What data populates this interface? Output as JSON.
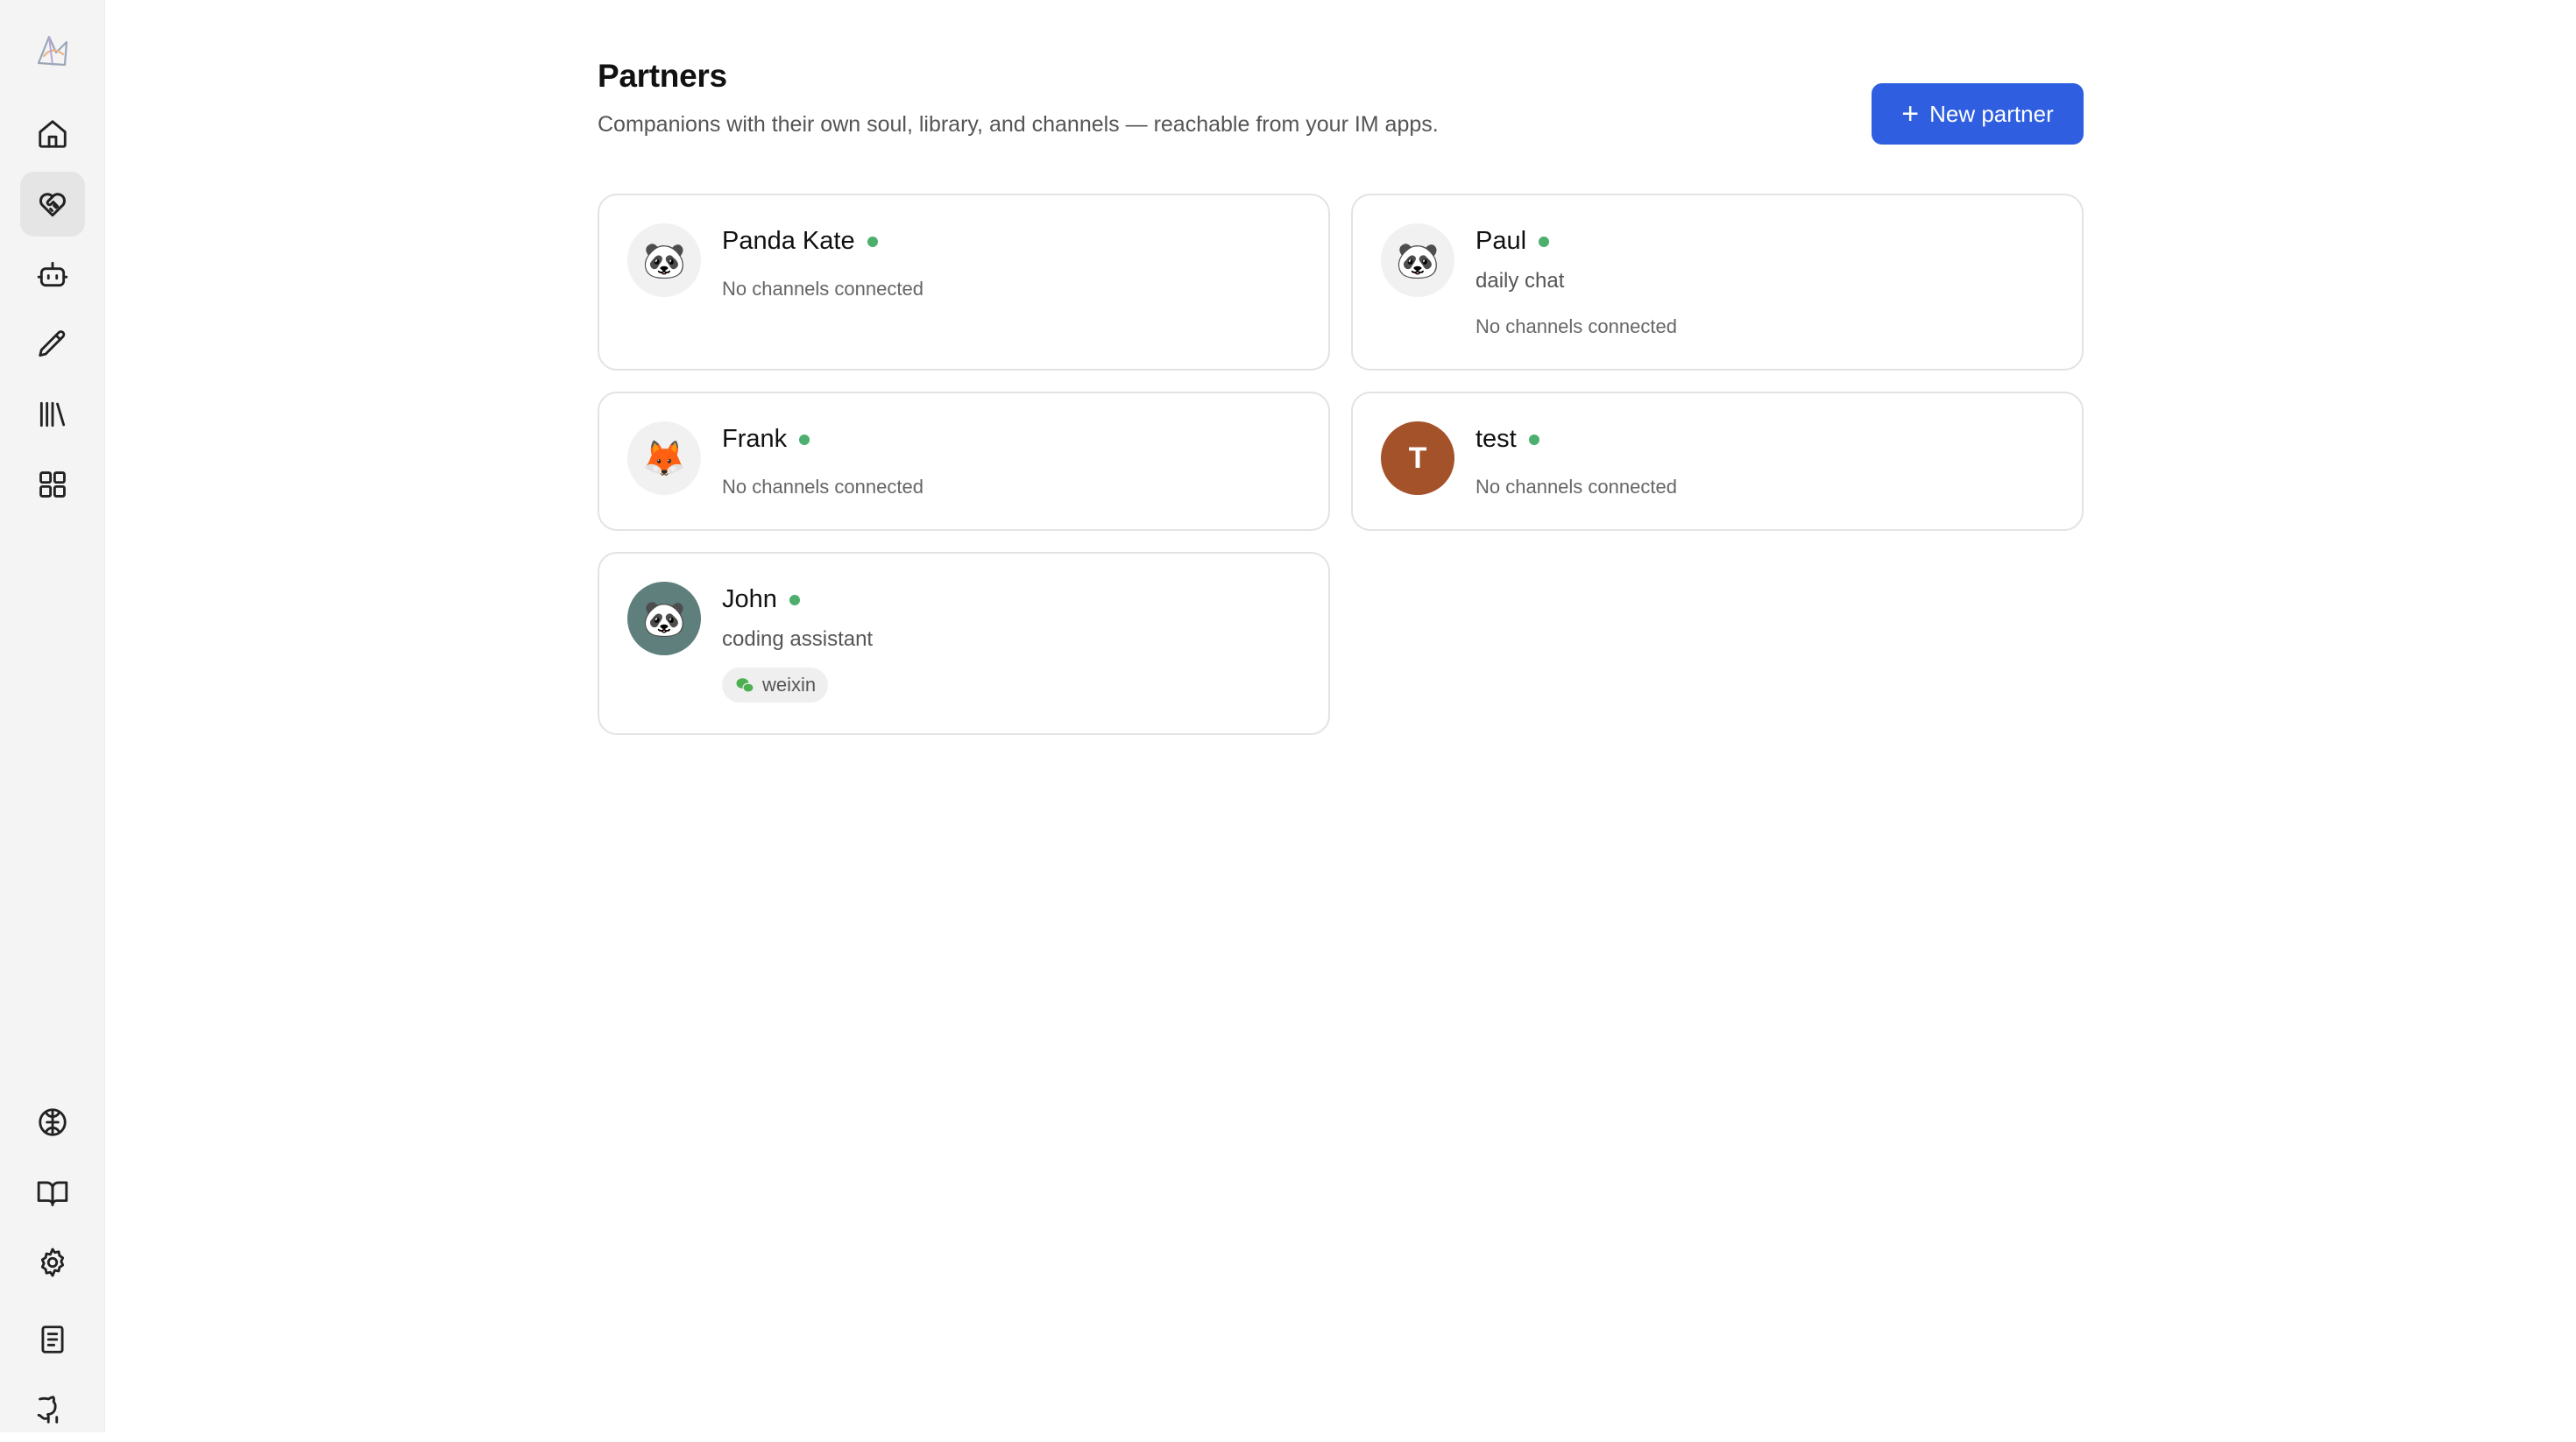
{
  "sidebar": {
    "logo": "app-logo",
    "top_items": [
      {
        "icon": "home-icon",
        "active": false
      },
      {
        "icon": "heart-handshake-icon",
        "active": true
      },
      {
        "icon": "bot-icon",
        "active": false
      },
      {
        "icon": "pencil-icon",
        "active": false
      },
      {
        "icon": "library-icon",
        "active": false
      },
      {
        "icon": "grid-icon",
        "active": false
      }
    ],
    "bottom_items": [
      {
        "icon": "brain-icon"
      },
      {
        "icon": "book-open-icon"
      },
      {
        "icon": "gear-icon"
      },
      {
        "icon": "document-icon"
      },
      {
        "icon": "github-icon"
      }
    ]
  },
  "header": {
    "title": "Partners",
    "subtitle": "Companions with their own soul, library, and channels — reachable from your IM apps.",
    "new_button_label": "New partner"
  },
  "partners": [
    {
      "name": "Panda Kate",
      "avatar": "🐼",
      "online": true,
      "description": "",
      "channels": "No channels connected"
    },
    {
      "name": "Paul",
      "avatar": "🐼",
      "online": true,
      "description": "daily chat",
      "channels": "No channels connected"
    },
    {
      "name": "Frank",
      "avatar": "🦊",
      "online": true,
      "description": "",
      "channels": "No channels connected"
    },
    {
      "name": "test",
      "avatar": "T",
      "online": true,
      "description": "",
      "channels": "No channels connected"
    },
    {
      "name": "John",
      "avatar": "🐼",
      "online": true,
      "description": "coding assistant",
      "channel_chip": "weixin"
    }
  ],
  "colors": {
    "accent": "#2f5fe0",
    "online": "#4caf6e",
    "letter_avatar": "#a4522a",
    "teal_avatar": "#5e7f7c",
    "wechat_green": "#4caf50"
  }
}
